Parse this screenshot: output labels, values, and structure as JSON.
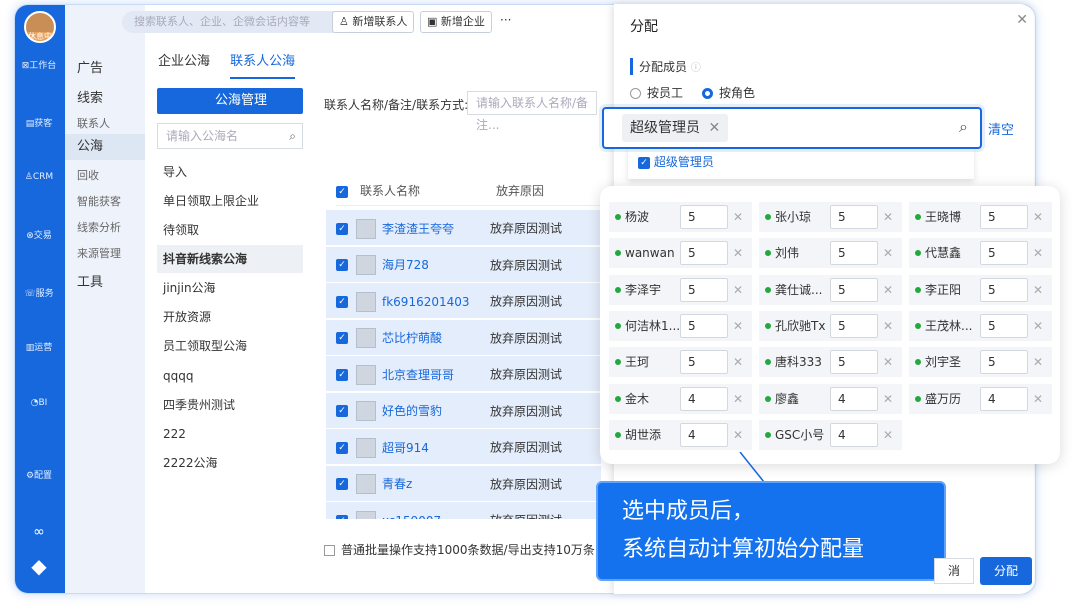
{
  "rail": {
    "status": "休息中",
    "items": [
      {
        "icon": "workbench-icon",
        "label": "工作台"
      },
      {
        "icon": "acquire-icon",
        "label": "获客"
      },
      {
        "icon": "crm-icon",
        "label": "CRM"
      },
      {
        "icon": "deal-icon",
        "label": "交易"
      },
      {
        "icon": "service-icon",
        "label": "服务"
      },
      {
        "icon": "operate-icon",
        "label": "运营"
      },
      {
        "icon": "bi-icon",
        "label": "BI"
      },
      {
        "icon": "settings-icon",
        "label": "配置"
      }
    ]
  },
  "menu": {
    "ads": "广告",
    "leads": "线索",
    "contacts": "联系人",
    "pool": "公海",
    "recycle": "回收",
    "smart": "智能获客",
    "analysis": "线索分析",
    "source": "来源管理",
    "tools": "工具"
  },
  "topbar": {
    "search_placeholder": "搜索联系人、企业、企微会话内容等",
    "add_contact": "新增联系人",
    "add_company": "新增企业",
    "more": "···"
  },
  "tabs": {
    "company": "企业公海",
    "contact": "联系人公海"
  },
  "left": {
    "manage": "公海管理",
    "search_placeholder": "请输入公海名",
    "pools": [
      "导入",
      "单日领取上限企业",
      "待领取",
      "抖音新线索公海",
      "jinjin公海",
      "开放资源",
      "员工领取型公海",
      "qqqq",
      "四季贵州测试",
      "222",
      "2222公海"
    ]
  },
  "filter": {
    "label": "联系人名称/备注/联系方式:",
    "placeholder": "请输入联系人名称/备注..."
  },
  "table": {
    "col1": "联系人名称",
    "col2": "放弃原因",
    "rows": [
      {
        "name": "李渣渣王夸夸",
        "reason": "放弃原因测试"
      },
      {
        "name": "海月728",
        "reason": "放弃原因测试"
      },
      {
        "name": "fk6916201403",
        "reason": "放弃原因测试"
      },
      {
        "name": "芯比柠萌酸",
        "reason": "放弃原因测试"
      },
      {
        "name": "北京查理哥哥",
        "reason": "放弃原因测试"
      },
      {
        "name": "好色的雪豹",
        "reason": "放弃原因测试"
      },
      {
        "name": "超哥914",
        "reason": "放弃原因测试"
      },
      {
        "name": "青春z",
        "reason": "放弃原因测试"
      },
      {
        "name": "xs159007",
        "reason": "放弃原因测试"
      }
    ]
  },
  "footer_note": "普通批量操作支持1000条数据/导出支持10万条",
  "drawer": {
    "title": "分配",
    "section": "分配成员",
    "by_employee": "按员工",
    "by_role": "按角色",
    "tag": "超级管理员",
    "clear": "清空",
    "dropdown_item": "超级管理员",
    "cancel": "消",
    "assign": "分配"
  },
  "members": [
    {
      "name": "杨波",
      "value": "5"
    },
    {
      "name": "张小琼",
      "value": "5"
    },
    {
      "name": "王晓博",
      "value": "5"
    },
    {
      "name": "wanwan",
      "value": "5"
    },
    {
      "name": "刘伟",
      "value": "5"
    },
    {
      "name": "代慧鑫",
      "value": "5"
    },
    {
      "name": "李泽宇",
      "value": "5"
    },
    {
      "name": "龚仕诚...",
      "value": "5"
    },
    {
      "name": "李正阳",
      "value": "5"
    },
    {
      "name": "何洁林1...",
      "value": "5"
    },
    {
      "name": "孔欣驰Tx",
      "value": "5"
    },
    {
      "name": "王茂林...",
      "value": "5"
    },
    {
      "name": "王珂",
      "value": "5"
    },
    {
      "name": "唐科333",
      "value": "5"
    },
    {
      "name": "刘宇圣",
      "value": "5"
    },
    {
      "name": "金木",
      "value": "4"
    },
    {
      "name": "廖鑫",
      "value": "4"
    },
    {
      "name": "盛万历",
      "value": "4"
    },
    {
      "name": "胡世添",
      "value": "4"
    },
    {
      "name": "GSC小号",
      "value": "4"
    }
  ],
  "callout": {
    "line1": "选中成员后，",
    "line2": "系统自动计算初始分配量"
  }
}
